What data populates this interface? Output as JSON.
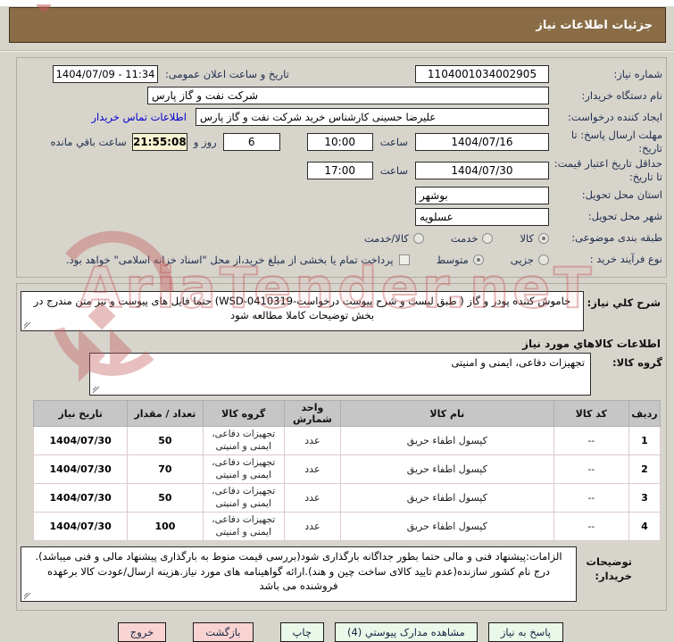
{
  "title_bar": {
    "title": "جزئيات اطلاعات نياز"
  },
  "watermark": {
    "text": "AriaTender.neT"
  },
  "form": {
    "need_number": {
      "label": "شماره نياز:",
      "value": "1104001034002905"
    },
    "announce_datetime": {
      "label": "تاريخ و ساعت اعلان عمومی:",
      "value": "1404/07/09 - 11:34"
    },
    "buyer_org": {
      "label": "نام دستگاه خريدار:",
      "value": "شرکت نفت و گاز پارس"
    },
    "request_creator": {
      "label": "ايجاد کننده درخواست:",
      "value": "علیرضا حسینی کارشناس خرید شرکت نفت و گاز پارس"
    },
    "buyer_contact_link": "اطلاعات تماس خريدار",
    "response_deadline": {
      "label": "مهلت ارسال پاسخ: تا تاريخ:",
      "date": "1404/07/16",
      "hour_label": "ساعت",
      "time": "10:00",
      "days_value": "6",
      "days_label": "روز و",
      "countdown": "21:55:08",
      "countdown_label": "ساعت باقي مانده"
    },
    "price_validity": {
      "label": "حداقل تاريخ اعتبار قيمت: تا تاريخ:",
      "date": "1404/07/30",
      "hour_label": "ساعت",
      "time": "17:00"
    },
    "province": {
      "label": "استان محل تحويل:",
      "value": "بوشهر"
    },
    "city": {
      "label": "شهر محل تحويل:",
      "value": "عسلویه"
    },
    "classification": {
      "label": "طبقه بندی موضوعی:",
      "options": [
        {
          "label": "کالا",
          "selected": true
        },
        {
          "label": "خدمت",
          "selected": false
        },
        {
          "label": "کالا/خدمت",
          "selected": false
        }
      ]
    },
    "process_type": {
      "label": "نوع فرآيند خريد :",
      "options": [
        {
          "label": "جزيی",
          "selected": false
        },
        {
          "label": "متوسط",
          "selected": true
        }
      ],
      "checkbox_label": "پرداخت تمام یا بخشی از مبلغ خرید،از محل \"اسناد خزانه اسلامی\" خواهد بود.",
      "checkbox_checked": false
    }
  },
  "need_description": {
    "label": "شرح کلي نياز:",
    "value": "خاموش کننده پودر و گاز ( طبق لیست و شرح پیوست درخواست-WSD-0410319) حتما فایل های پیوست و نیز متن مندرج در بخش توضیحات کاملا مطالعه شود"
  },
  "goods_section": {
    "title": "اطلاعات کالاهاي مورد نياز",
    "group_label": "گروه کالا:",
    "group_value": "تجهیزات دفاعی، ایمنی و امنیتی"
  },
  "table": {
    "headers": [
      "ردیف",
      "کد کالا",
      "نام کالا",
      "واحد شمارش",
      "گروه کالا",
      "تعداد / مقدار",
      "تاریخ نیاز"
    ],
    "rows": [
      [
        "1",
        "--",
        "کپسول اطفاء حریق",
        "عدد",
        "تجهیزات دفاعی، ایمنی و امنیتی",
        "50",
        "1404/07/30"
      ],
      [
        "2",
        "--",
        "کپسول اطفاء حریق",
        "عدد",
        "تجهیزات دفاعی، ایمنی و امنیتی",
        "70",
        "1404/07/30"
      ],
      [
        "3",
        "--",
        "کپسول اطفاء حریق",
        "عدد",
        "تجهیزات دفاعی، ایمنی و امنیتی",
        "50",
        "1404/07/30"
      ],
      [
        "4",
        "--",
        "کپسول اطفاء حریق",
        "عدد",
        "تجهیزات دفاعی، ایمنی و امنیتی",
        "100",
        "1404/07/30"
      ]
    ]
  },
  "buyer_notes": {
    "label": "توضیحات خریدار:",
    "value": "الزامات:پیشنهاد فنی و مالی حتما  بطور جداگانه بارگذاری شود(بررسی قیمت منوط به بارگذاری پیشنهاد مالی و فنی میباشد). درج نام کشور سازنده(عدم تایید کالای ساخت چین و هند).ارائه گواهینامه های مورد نیاز.هزینه ارسال/عودت کالا برعهده فروشنده می باشد"
  },
  "footer": {
    "buttons": [
      {
        "label": "پاسخ به نياز",
        "type": "green"
      },
      {
        "label": "مشاهده مدارک پيوستي (4)",
        "type": "green"
      },
      {
        "label": "چاپ",
        "type": "green"
      },
      {
        "label": "بازگشت",
        "type": "pink"
      },
      {
        "label": "خروج",
        "type": "pink"
      }
    ]
  },
  "colors": {
    "titlebar_bg": "#8a6d46",
    "page_bg": "#d7d4cc",
    "countdown_bg": "#f8f3d3",
    "table_header_bg": "#c6c6c6",
    "button_green": "#e9f8e9",
    "button_pink": "#f8d3d1",
    "link_blue": "#0000cc",
    "watermark_red": "#c45858"
  }
}
